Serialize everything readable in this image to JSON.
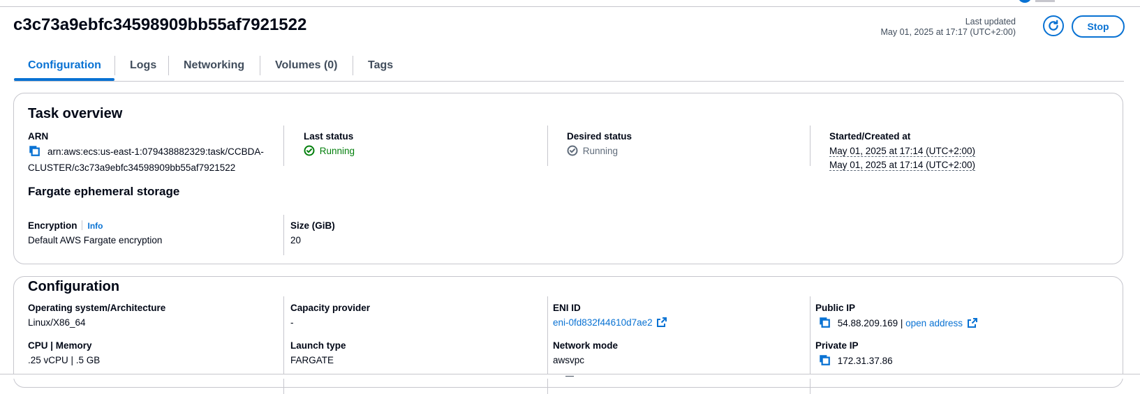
{
  "page": {
    "title": "c3c73a9ebfc34598909bb55af7921522"
  },
  "header": {
    "last_updated_label": "Last updated",
    "last_updated_value": "May 01, 2025 at 17:17 (UTC+2:00)",
    "refresh_icon": "refresh-icon",
    "stop_label": "Stop"
  },
  "tabs": [
    {
      "label": "Configuration",
      "active": true
    },
    {
      "label": "Logs"
    },
    {
      "label": "Networking"
    },
    {
      "label": "Volumes (0)"
    },
    {
      "label": "Tags"
    }
  ],
  "task_overview": {
    "heading": "Task overview",
    "arn_label": "ARN",
    "arn_line1": "arn:aws:ecs:us-east-1:079438882329:task/CCBDA-",
    "arn_line2": "CLUSTER/c3c73a9ebfc34598909bb55af7921522",
    "last_status_label": "Last status",
    "last_status_value": "Running",
    "desired_status_label": "Desired status",
    "desired_status_value": "Running",
    "started_label": "Started/Created at",
    "started_value": "May 01, 2025 at 17:14 (UTC+2:00)",
    "created_value": "May 01, 2025 at 17:14 (UTC+2:00)"
  },
  "ephemeral_storage": {
    "heading": "Fargate ephemeral storage",
    "encryption_label": "Encryption",
    "info_label": "Info",
    "encryption_value": "Default AWS Fargate encryption",
    "size_label": "Size (GiB)",
    "size_value": "20"
  },
  "configuration": {
    "heading": "Configuration",
    "os_label": "Operating system/Architecture",
    "os_value": "Linux/X86_64",
    "capacity_label": "Capacity provider",
    "capacity_value": "-",
    "eni_label": "ENI ID",
    "eni_value": "eni-0fd832f44610d7ae2",
    "public_ip_label": "Public IP",
    "public_ip_value": "54.88.209.169",
    "public_ip_sep": "|",
    "open_address_label": "open address",
    "cpu_label": "CPU | Memory",
    "cpu_value": ".25 vCPU | .5 GB",
    "launch_label": "Launch type",
    "launch_value": "FARGATE",
    "network_mode_label": "Network mode",
    "network_mode_value": "awsvpc",
    "private_ip_label": "Private IP",
    "private_ip_value": "172.31.37.86"
  },
  "colors": {
    "accent": "#0972d3",
    "success": "#037f0c",
    "border": "#c6c6cd"
  }
}
